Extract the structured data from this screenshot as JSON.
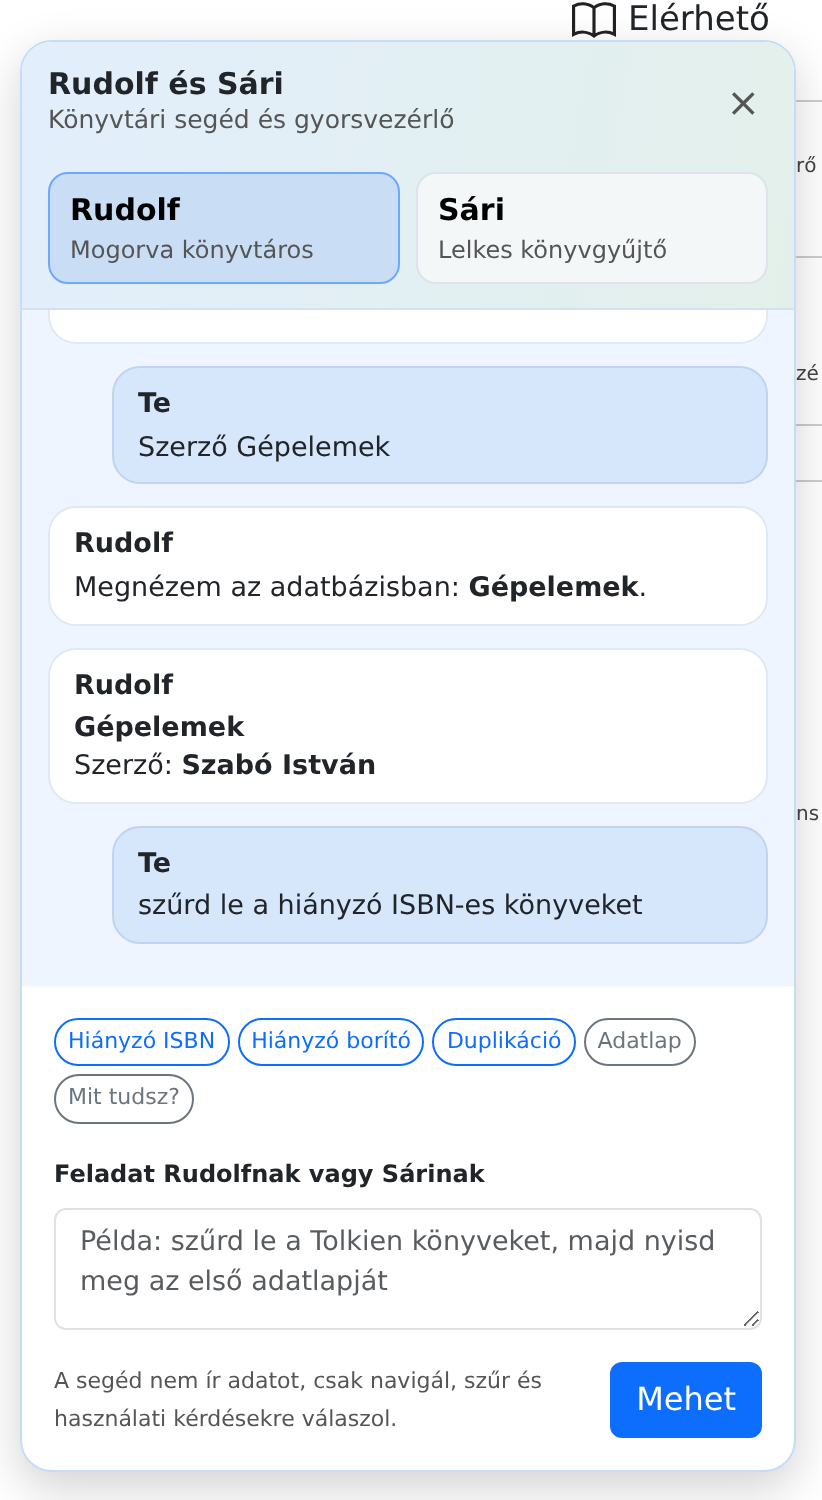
{
  "background_page": {
    "title": "Elérhető",
    "fragments": [
      "rő",
      "zé",
      "ns"
    ]
  },
  "panel": {
    "title": "Rudolf és Sári",
    "subtitle": "Könyvtári segéd és gyorsvezérlő",
    "close": "×"
  },
  "personas": [
    {
      "name": "Rudolf",
      "description": "Mogorva könyvtáros",
      "selected": true
    },
    {
      "name": "Sári",
      "description": "Lelkes könyvgyűjtő",
      "selected": false
    }
  ],
  "messages": [
    {
      "kind": "user",
      "sender": "Te",
      "lines": [
        "Szerző Gépelemek"
      ]
    },
    {
      "kind": "bot",
      "sender": "Rudolf",
      "lines": [
        "Megnézem az adatbázisban: **Gépelemek**."
      ]
    },
    {
      "kind": "bot",
      "sender": "Rudolf",
      "lines": [
        "**Gépelemek**",
        "Szerző: **Szabó István**"
      ]
    },
    {
      "kind": "user",
      "sender": "Te",
      "lines": [
        "szűrd le a hiányzó ISBN-es könyveket"
      ]
    }
  ],
  "chips": [
    {
      "label": "Hiányzó ISBN",
      "kind": "primary"
    },
    {
      "label": "Hiányzó borító",
      "kind": "primary"
    },
    {
      "label": "Duplikáció",
      "kind": "primary"
    },
    {
      "label": "Adatlap",
      "kind": "secondary"
    },
    {
      "label": "Mit tudsz?",
      "kind": "secondary"
    }
  ],
  "task": {
    "label": "Feladat Rudolfnak vagy Sárinak",
    "placeholder": "Példa: szűrd le a Tolkien könyveket, majd nyisd meg az első adatlapját"
  },
  "footer": {
    "note": "A segéd nem ír adatot, csak navigál, szűr és használati kérdésekre válaszol.",
    "button": "Mehet"
  }
}
